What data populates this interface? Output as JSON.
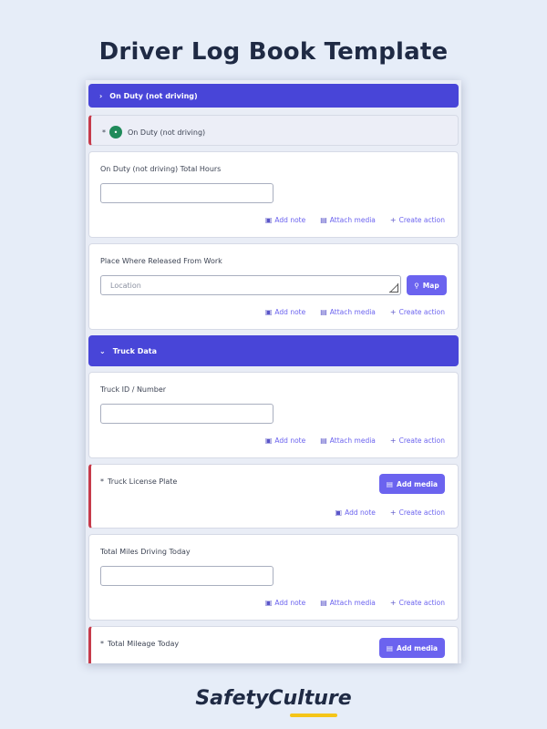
{
  "page_title": "Driver Log Book Template",
  "brand_logo": "SafetyCulture",
  "colors": {
    "accent": "#4845d8",
    "button": "#6b63ef",
    "required": "#c63b4b",
    "status": "#1f8a5a"
  },
  "sections": {
    "on_duty_label": "On Duty (not driving)",
    "truck_data_label": "Truck Data"
  },
  "status_row": {
    "label": "On Duty (not driving)"
  },
  "questions": {
    "on_duty_hours": {
      "label": "On Duty (not driving) Total Hours"
    },
    "place_released": {
      "label": "Place Where Released From Work",
      "placeholder": "Location",
      "map_label": "Map"
    },
    "truck_id": {
      "label": "Truck ID / Number"
    },
    "license_plate": {
      "label": "Truck License Plate",
      "add_media_label": "Add media"
    },
    "total_miles": {
      "label": "Total Miles Driving Today"
    },
    "total_mileage": {
      "label": "Total Mileage Today",
      "add_media_label": "Add media"
    }
  },
  "actions": {
    "add_note": "Add note",
    "attach_media": "Attach media",
    "create_action": "Create action"
  }
}
